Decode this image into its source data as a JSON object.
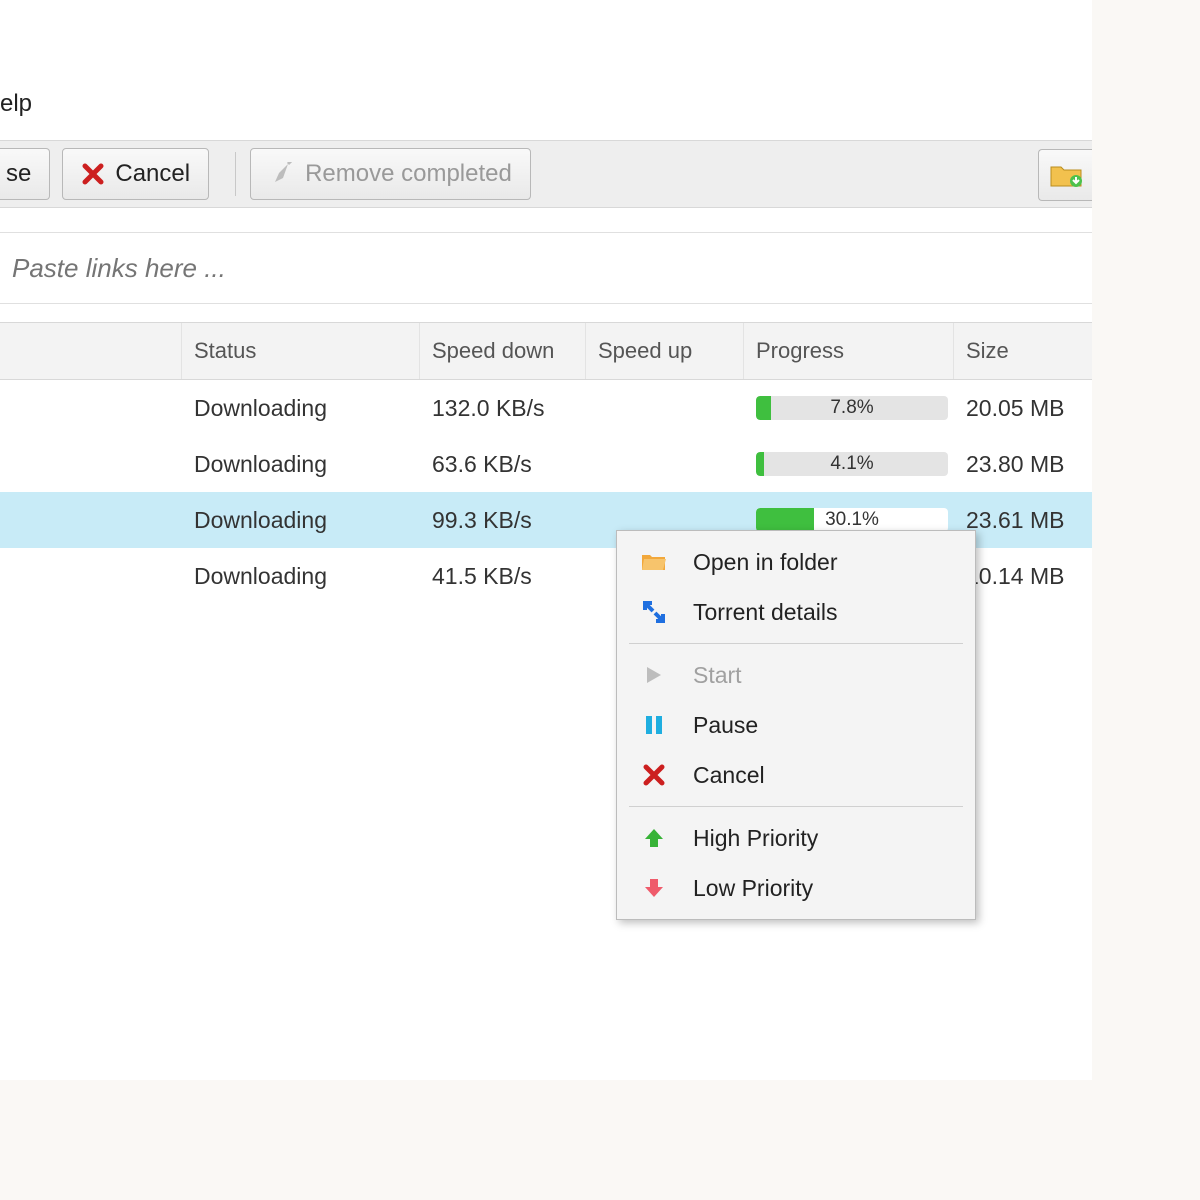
{
  "menu": {
    "help_fragment": "elp"
  },
  "toolbar": {
    "pause_fragment": "se",
    "cancel": "Cancel",
    "remove_completed": "Remove completed"
  },
  "paste": {
    "placeholder": "Paste links here ..."
  },
  "columns": {
    "status": "Status",
    "speed_down": "Speed down",
    "speed_up": "Speed up",
    "progress": "Progress",
    "size": "Size"
  },
  "rows": [
    {
      "status": "Downloading",
      "speed_down": "132.0 KB/s",
      "speed_up": "",
      "progress": 7.8,
      "progress_label": "7.8%",
      "size": "20.05 MB",
      "selected": false
    },
    {
      "status": "Downloading",
      "speed_down": "63.6 KB/s",
      "speed_up": "",
      "progress": 4.1,
      "progress_label": "4.1%",
      "size": "23.80 MB",
      "selected": false
    },
    {
      "status": "Downloading",
      "speed_down": "99.3 KB/s",
      "speed_up": "",
      "progress": 30.1,
      "progress_label": "30.1%",
      "size": "23.61 MB",
      "selected": true
    },
    {
      "status": "Downloading",
      "speed_down": "41.5 KB/s",
      "speed_up": "",
      "progress": 0,
      "progress_label": "",
      "size": "10.14 MB",
      "selected": false
    }
  ],
  "context_menu": {
    "open_in_folder": "Open in folder",
    "torrent_details": "Torrent details",
    "start": "Start",
    "pause": "Pause",
    "cancel": "Cancel",
    "high_priority": "High Priority",
    "low_priority": "Low Priority"
  }
}
